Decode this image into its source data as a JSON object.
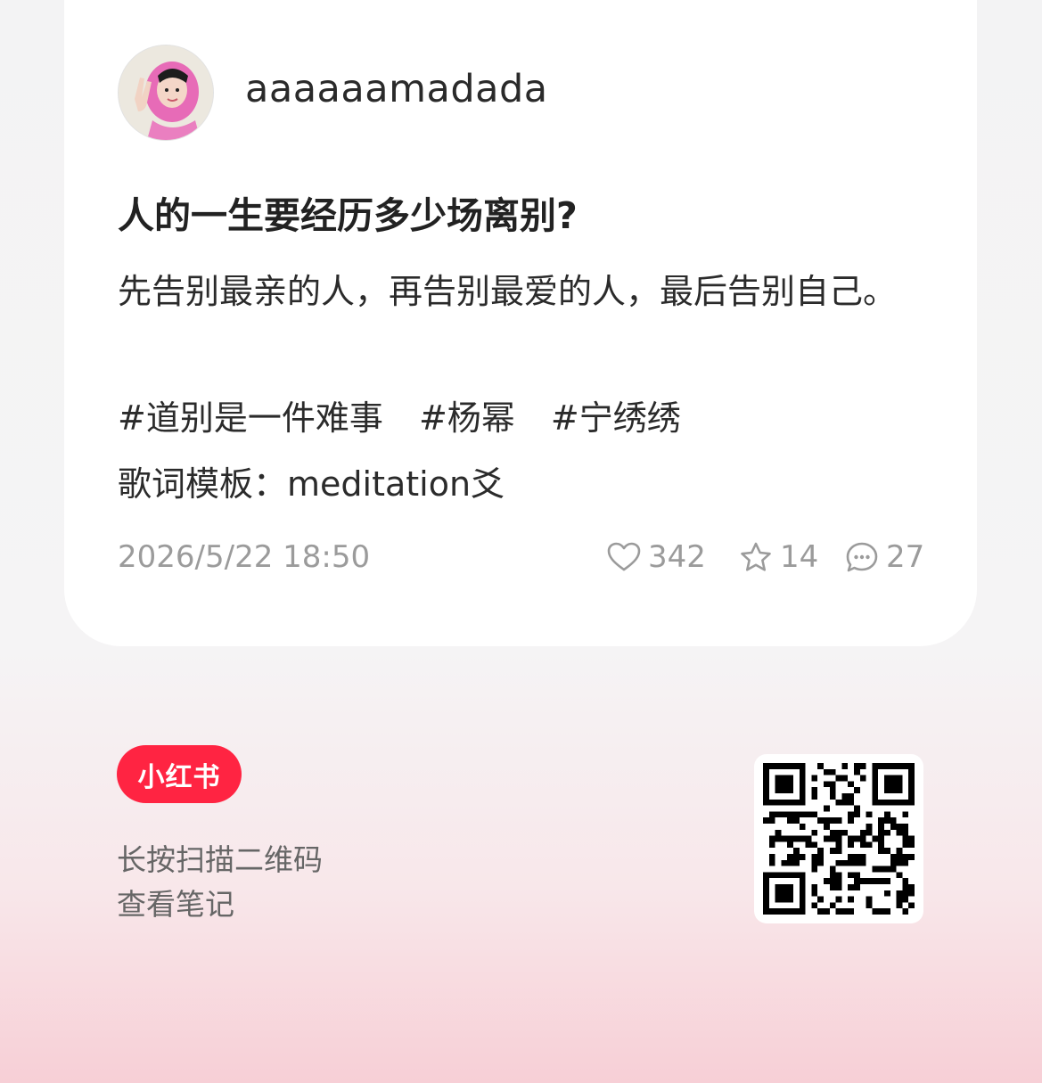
{
  "post": {
    "username": "aaaaaamadada",
    "title": "人的一生要经历多少场离别?",
    "body": "先告别最亲的人，再告别最爱的人，最后告别自己。",
    "tags": [
      "#道别是一件难事",
      "#杨幂",
      "#宁绣绣"
    ],
    "lyric_template": "歌词模板：meditation爻",
    "datetime": "2026/5/22 18:50",
    "likes": "342",
    "collects": "14",
    "comments": "27"
  },
  "footer": {
    "brand": "小红书",
    "scan_line1": "长按扫描二维码",
    "scan_line2": "查看笔记"
  },
  "icons": [
    "avatar-photo",
    "heart-icon",
    "star-icon",
    "comment-icon",
    "qr-code"
  ],
  "colors": {
    "brand_red": "#ff2442",
    "text_dark": "#222222",
    "text_meta": "#9b9b9b"
  }
}
